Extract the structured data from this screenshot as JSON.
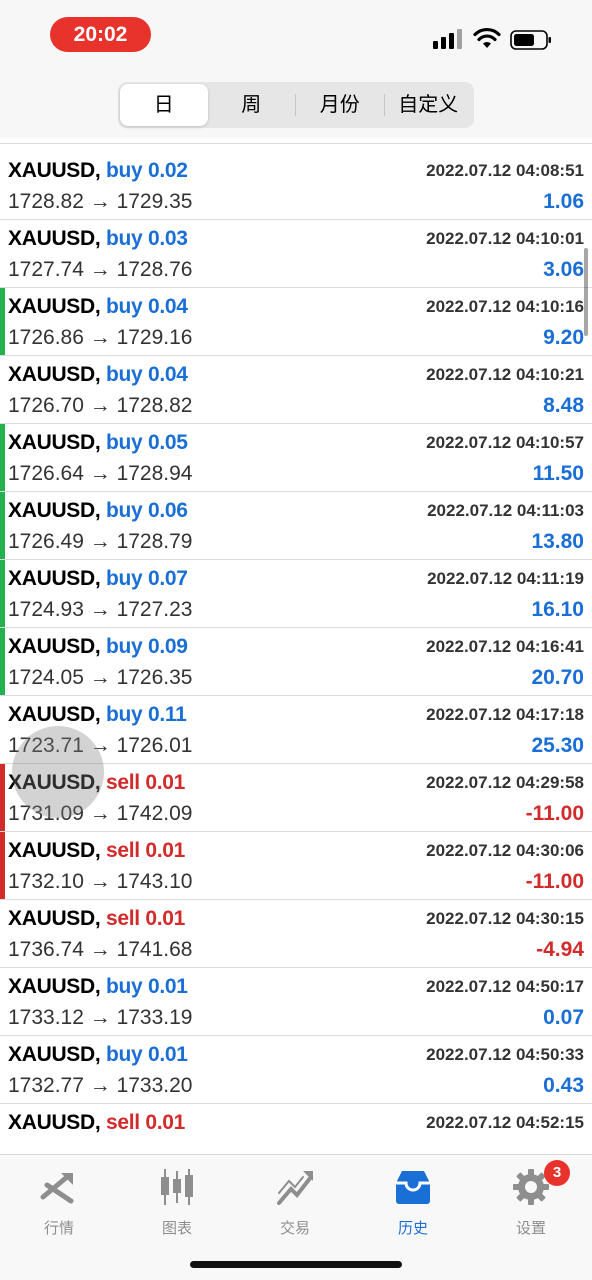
{
  "status": {
    "time": "20:02"
  },
  "segments": [
    {
      "label": "日",
      "active": true
    },
    {
      "label": "周",
      "active": false
    },
    {
      "label": "月份",
      "active": false
    },
    {
      "label": "自定义",
      "active": false
    }
  ],
  "rows": [
    {
      "symbol": "XAUUSD,",
      "side": "buy 0.02",
      "type": "buy",
      "prices": "1728.82 → 1729.35",
      "datetime": "2022.07.12 04:08:51",
      "profit": "1.06",
      "bar": ""
    },
    {
      "symbol": "XAUUSD,",
      "side": "buy 0.03",
      "type": "buy",
      "prices": "1727.74 → 1728.76",
      "datetime": "2022.07.12 04:10:01",
      "profit": "3.06",
      "bar": ""
    },
    {
      "symbol": "XAUUSD,",
      "side": "buy 0.04",
      "type": "buy",
      "prices": "1726.86 → 1729.16",
      "datetime": "2022.07.12 04:10:16",
      "profit": "9.20",
      "bar": "#22b14c"
    },
    {
      "symbol": "XAUUSD,",
      "side": "buy 0.04",
      "type": "buy",
      "prices": "1726.70 → 1728.82",
      "datetime": "2022.07.12 04:10:21",
      "profit": "8.48",
      "bar": ""
    },
    {
      "symbol": "XAUUSD,",
      "side": "buy 0.05",
      "type": "buy",
      "prices": "1726.64 → 1728.94",
      "datetime": "2022.07.12 04:10:57",
      "profit": "11.50",
      "bar": "#22b14c"
    },
    {
      "symbol": "XAUUSD,",
      "side": "buy 0.06",
      "type": "buy",
      "prices": "1726.49 → 1728.79",
      "datetime": "2022.07.12 04:11:03",
      "profit": "13.80",
      "bar": "#22b14c"
    },
    {
      "symbol": "XAUUSD,",
      "side": "buy 0.07",
      "type": "buy",
      "prices": "1724.93 → 1727.23",
      "datetime": "2022.07.12 04:11:19",
      "profit": "16.10",
      "bar": "#22b14c"
    },
    {
      "symbol": "XAUUSD,",
      "side": "buy 0.09",
      "type": "buy",
      "prices": "1724.05 → 1726.35",
      "datetime": "2022.07.12 04:16:41",
      "profit": "20.70",
      "bar": "#22b14c"
    },
    {
      "symbol": "XAUUSD,",
      "side": "buy 0.11",
      "type": "buy",
      "prices": "1723.71 → 1726.01",
      "datetime": "2022.07.12 04:17:18",
      "profit": "25.30",
      "bar": ""
    },
    {
      "symbol": "XAUUSD,",
      "side": "sell 0.01",
      "type": "sell",
      "prices": "1731.09 → 1742.09",
      "datetime": "2022.07.12 04:29:58",
      "profit": "-11.00",
      "bar": "#d22b2b"
    },
    {
      "symbol": "XAUUSD,",
      "side": "sell 0.01",
      "type": "sell",
      "prices": "1732.10 → 1743.10",
      "datetime": "2022.07.12 04:30:06",
      "profit": "-11.00",
      "bar": "#d22b2b"
    },
    {
      "symbol": "XAUUSD,",
      "side": "sell 0.01",
      "type": "sell",
      "prices": "1736.74 → 1741.68",
      "datetime": "2022.07.12 04:30:15",
      "profit": "-4.94",
      "bar": ""
    },
    {
      "symbol": "XAUUSD,",
      "side": "buy 0.01",
      "type": "buy",
      "prices": "1733.12 → 1733.19",
      "datetime": "2022.07.12 04:50:17",
      "profit": "0.07",
      "bar": ""
    },
    {
      "symbol": "XAUUSD,",
      "side": "buy 0.01",
      "type": "buy",
      "prices": "1732.77 → 1733.20",
      "datetime": "2022.07.12 04:50:33",
      "profit": "0.43",
      "bar": ""
    },
    {
      "symbol": "XAUUSD,",
      "side": "sell 0.01",
      "type": "sell",
      "prices": "",
      "datetime": "2022.07.12 04:52:15",
      "profit": "",
      "bar": ""
    }
  ],
  "tabs": [
    {
      "label": "行情",
      "icon": "quotes-icon",
      "active": false
    },
    {
      "label": "图表",
      "icon": "chart-icon",
      "active": false
    },
    {
      "label": "交易",
      "icon": "trade-icon",
      "active": false
    },
    {
      "label": "历史",
      "icon": "history-icon",
      "active": true
    },
    {
      "label": "设置",
      "icon": "settings-icon",
      "active": false
    }
  ],
  "settings_badge": "3",
  "colors": {
    "buy": "#1a6fd6",
    "sell": "#d22b2b",
    "profit_bar": "#22b14c",
    "active_tab": "#1a6fd6"
  }
}
